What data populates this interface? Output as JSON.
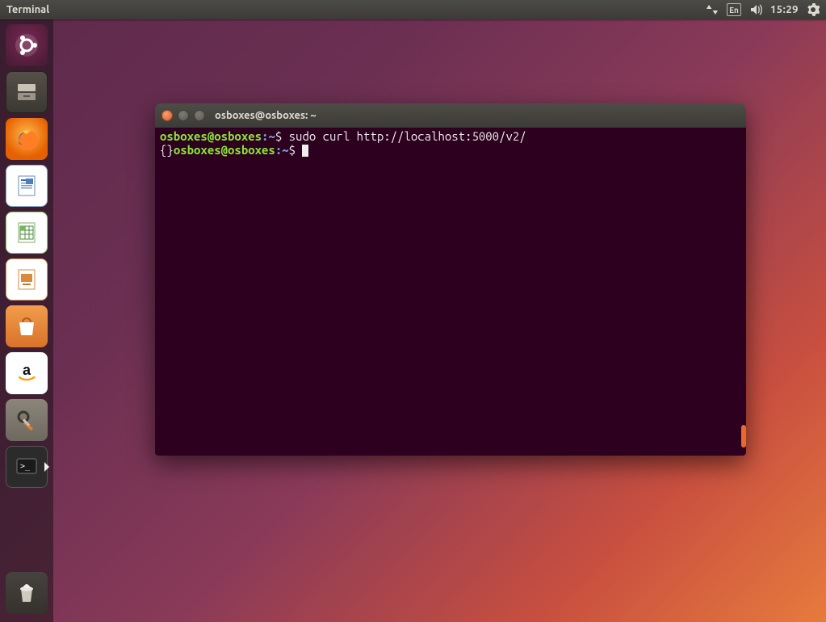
{
  "menubar": {
    "app_title": "Terminal",
    "keyboard_indicator": "En",
    "clock": "15:29"
  },
  "launcher": {
    "items": [
      {
        "name": "dash"
      },
      {
        "name": "files"
      },
      {
        "name": "firefox"
      },
      {
        "name": "libreoffice-writer"
      },
      {
        "name": "libreoffice-calc"
      },
      {
        "name": "libreoffice-impress"
      },
      {
        "name": "ubuntu-software"
      },
      {
        "name": "amazon"
      },
      {
        "name": "system-settings"
      },
      {
        "name": "terminal"
      }
    ],
    "trash": "trash"
  },
  "terminal": {
    "window_title": "osboxes@osboxes: ~",
    "lines": [
      {
        "user": "osboxes",
        "host": "osboxes",
        "path": "~",
        "command": "sudo curl http://localhost:5000/v2/"
      },
      {
        "output": "{}",
        "followed_by_prompt": true,
        "user": "osboxes",
        "host": "osboxes",
        "path": "~",
        "command": ""
      }
    ]
  }
}
